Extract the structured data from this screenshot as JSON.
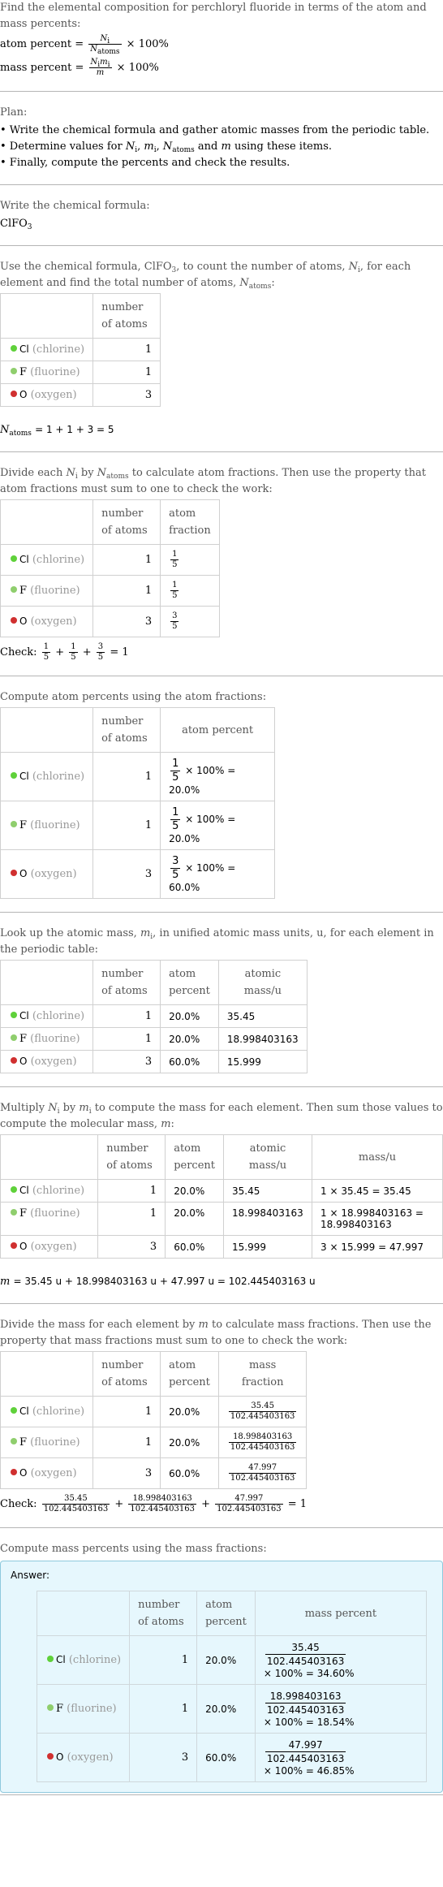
{
  "intro": {
    "question": "Find the elemental composition for perchloryl fluoride in terms of the atom and mass percents:",
    "atom_percent_label": "atom percent = ",
    "mass_percent_label": "mass percent = ",
    "times_100": "× 100%"
  },
  "plan": {
    "title": "Plan:",
    "items": [
      "• Write the chemical formula and gather atomic masses from the periodic table.",
      "• Determine values for N_i, m_i, N_atoms and m using these items.",
      "• Finally, compute the percents and check the results."
    ]
  },
  "formula": {
    "intro": "Write the chemical formula:",
    "base": "ClFO",
    "sub": "3"
  },
  "headers": {
    "number_of_atoms": "number of atoms",
    "atom_fraction": "atom fraction",
    "atom_percent": "atom percent",
    "atomic_mass": "atomic mass/u",
    "mass": "mass/u",
    "mass_fraction": "mass fraction",
    "mass_percent": "mass percent"
  },
  "elements": [
    {
      "symbol": "Cl",
      "name": "(chlorine)",
      "color": "#5fd13a",
      "count": "1",
      "frac_num": "1",
      "frac_den": "5",
      "atom_percent_result": "× 100% = 20.0%",
      "atom_percent": "20.0%",
      "atomic_mass": "35.45",
      "mass_calc": "1 × 35.45 = 35.45",
      "mass": "35.45",
      "molar": "102.445403163",
      "mass_percent_result": "× 100% = 34.60%"
    },
    {
      "symbol": "F",
      "name": "(fluorine)",
      "color": "#8fce6d",
      "count": "1",
      "frac_num": "1",
      "frac_den": "5",
      "atom_percent_result": "× 100% = 20.0%",
      "atom_percent": "20.0%",
      "atomic_mass": "18.998403163",
      "mass_calc": "1 × 18.998403163 = 18.998403163",
      "mass": "18.998403163",
      "molar": "102.445403163",
      "mass_percent_result": "× 100% = 18.54%"
    },
    {
      "symbol": "O",
      "name": "(oxygen)",
      "color": "#d03030",
      "count": "3",
      "frac_num": "3",
      "frac_den": "5",
      "atom_percent_result": "× 100% = 60.0%",
      "atom_percent": "60.0%",
      "atomic_mass": "15.999",
      "mass_calc": "3 × 15.999 = 47.997",
      "mass": "47.997",
      "molar": "102.445403163",
      "mass_percent_result": "× 100% = 46.85%"
    }
  ],
  "step_count": {
    "intro": "Use the chemical formula, ClFO3, to count the number of atoms, N_i, for each element and find the total number of atoms, N_atoms:",
    "result": "= 1 + 1 + 3 = 5"
  },
  "step_fraction": {
    "intro": "Divide each N_i by N_atoms to calculate atom fractions. Then use the property that atom fractions must sum to one to check the work:",
    "check_label": "Check:",
    "check_result": "= 1"
  },
  "step_atom_percent": {
    "intro": "Compute atom percents using the atom fractions:"
  },
  "step_lookup": {
    "intro": "Look up the atomic mass, m_i, in unified atomic mass units, u, for each element in the periodic table:"
  },
  "step_mass": {
    "intro": "Multiply N_i by m_i to compute the mass for each element. Then sum those values to compute the molecular mass, m:",
    "sum": "= 35.45 u + 18.998403163 u + 47.997 u = 102.445403163 u"
  },
  "step_mass_fraction": {
    "intro": "Divide the mass for each element by m to calculate mass fractions. Then use the property that mass fractions must sum to one to check the work:",
    "check_label": "Check:",
    "check_result": "= 1"
  },
  "step_mass_percent": {
    "intro": "Compute mass percents using the mass fractions:",
    "answer_label": "Answer:"
  }
}
